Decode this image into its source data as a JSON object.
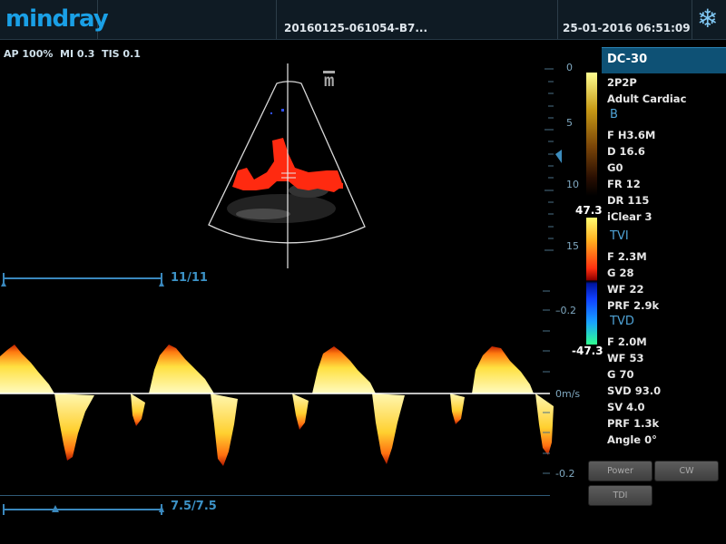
{
  "header": {
    "logo": "mindray",
    "patient_id": "20160125-061054-B7...",
    "datetime": "25-01-2016 06:51:09",
    "freeze_icon": "snowflake-icon"
  },
  "status_line": "AP 100%  MI 0.3  TIS 0.1",
  "image_area": {
    "orientation_mark": "m",
    "depth_scale": [
      "0",
      "5",
      "10",
      "15"
    ],
    "b_line_label": "11/11",
    "doppler_line_label": "7.5/7.5",
    "velocity_scale": [
      "0.2",
      "0m/s",
      "-0.2"
    ]
  },
  "color_bar": {
    "max": "47.3",
    "min": "-47.3"
  },
  "panel": {
    "probe": "DC-30",
    "lines": [
      {
        "text": "2P2P",
        "type": "param"
      },
      {
        "text": "Adult Cardiac",
        "type": "param"
      },
      {
        "text": "B",
        "type": "section"
      },
      {
        "text": "F H3.6M",
        "type": "param"
      },
      {
        "text": "D 16.6",
        "type": "param"
      },
      {
        "text": "G0",
        "type": "param"
      },
      {
        "text": "FR 12",
        "type": "param"
      },
      {
        "text": "DR 115",
        "type": "param"
      },
      {
        "text": "iClear 3",
        "type": "param"
      },
      {
        "text": "TVI",
        "type": "section"
      },
      {
        "text": "F 2.3M",
        "type": "param"
      },
      {
        "text": "G 28",
        "type": "param"
      },
      {
        "text": "WF 22",
        "type": "param"
      },
      {
        "text": "PRF 2.9k",
        "type": "param"
      },
      {
        "text": "TVD",
        "type": "section"
      },
      {
        "text": "F 2.0M",
        "type": "param"
      },
      {
        "text": "WF 53",
        "type": "param"
      },
      {
        "text": "G 70",
        "type": "param"
      },
      {
        "text": "SVD 93.0",
        "type": "param"
      },
      {
        "text": "SV 4.0",
        "type": "param"
      },
      {
        "text": "PRF 1.3k",
        "type": "param"
      },
      {
        "text": "Angle 0°",
        "type": "param"
      }
    ],
    "buttons": {
      "power": "Power",
      "cw": "CW",
      "tdi": "TDI"
    }
  },
  "colors": {
    "accent": "#1aa0e6",
    "section": "#4fa3d6",
    "doppler_red": "#ff2a10"
  }
}
